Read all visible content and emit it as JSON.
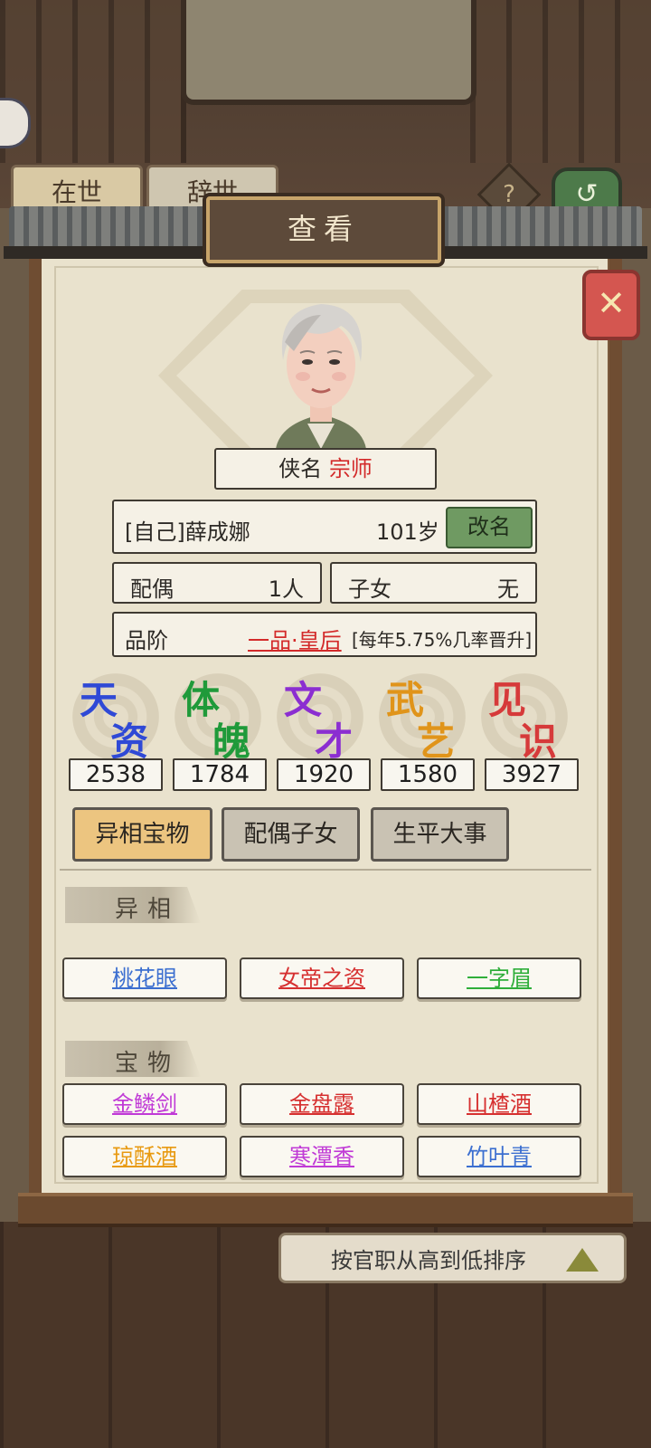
{
  "background": {
    "tabs": [
      "在世",
      "辞世"
    ],
    "sort_label": "按官职从高到低排序"
  },
  "header": {
    "title": "查看"
  },
  "profile": {
    "nick_label": "侠名",
    "nick_value": "宗师",
    "identity": "[自己]薛成娜",
    "age": "101岁",
    "rename_label": "改名",
    "spouse_label": "配偶",
    "spouse_value": "1人",
    "children_label": "子女",
    "children_value": "无",
    "rank_label": "品阶",
    "rank_value": "一品·皇后",
    "rank_note": "[每年5.75%几率晋升]"
  },
  "stats": [
    {
      "c1": "天",
      "c2": "资",
      "value": "2538",
      "color": "#2f49d6"
    },
    {
      "c1": "体",
      "c2": "魄",
      "value": "1784",
      "color": "#1f9a3a"
    },
    {
      "c1": "文",
      "c2": "才",
      "value": "1920",
      "color": "#8b2ed1"
    },
    {
      "c1": "武",
      "c2": "艺",
      "value": "1580",
      "color": "#e0941a"
    },
    {
      "c1": "见",
      "c2": "识",
      "value": "3927",
      "color": "#d63a3a"
    }
  ],
  "tabs": {
    "traits_treasures": "异相宝物",
    "spouse_children": "配偶子女",
    "life_events": "生平大事"
  },
  "traits": {
    "title": "异相",
    "items": [
      {
        "label": "桃花眼",
        "color": "#3c6fd0"
      },
      {
        "label": "女帝之资",
        "color": "#d63030"
      },
      {
        "label": "一字眉",
        "color": "#2fae3a"
      }
    ]
  },
  "treasures": {
    "title": "宝物",
    "items": [
      {
        "label": "金鳞剑",
        "color": "#c03ad6"
      },
      {
        "label": "金盘露",
        "color": "#d63030"
      },
      {
        "label": "山楂酒",
        "color": "#d63030"
      },
      {
        "label": "琼酥酒",
        "color": "#e89a12"
      },
      {
        "label": "寒潭香",
        "color": "#c03ad6"
      },
      {
        "label": "竹叶青",
        "color": "#3c6fd0"
      }
    ]
  }
}
